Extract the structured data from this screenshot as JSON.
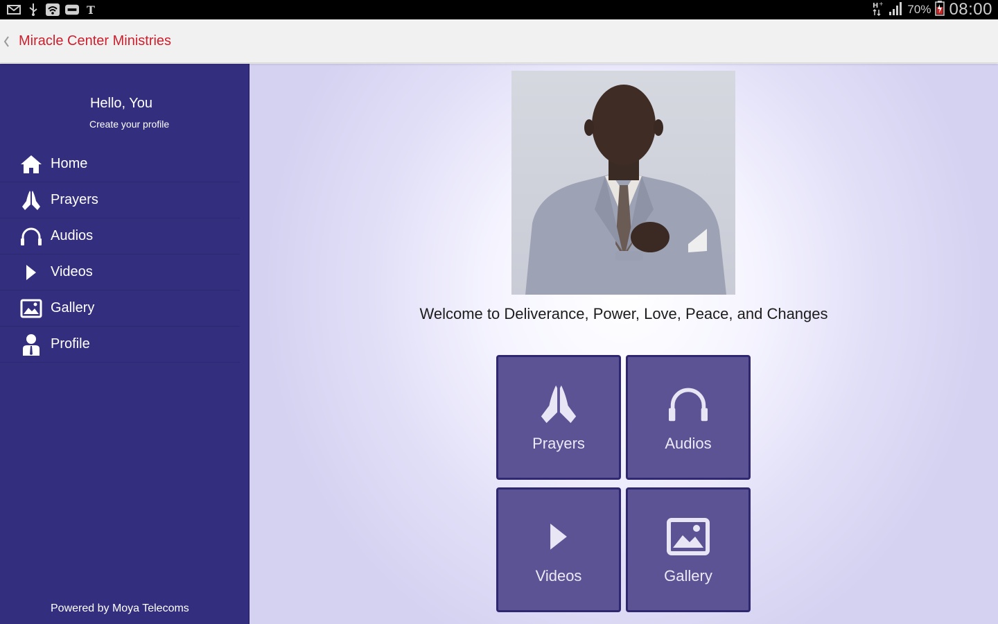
{
  "status_bar": {
    "battery_percent": "70%",
    "time": "08:00",
    "icons": [
      "mail-icon",
      "usb-icon",
      "wifi-icon",
      "storage-icon",
      "nyt-icon",
      "network-type-icon",
      "signal-icon",
      "battery-icon"
    ]
  },
  "action_bar": {
    "title": "Miracle Center Ministries",
    "title_color": "#cc1f2d"
  },
  "drawer": {
    "greeting": "Hello, You",
    "profile_link": "Create your profile",
    "items": [
      {
        "label": "Home",
        "icon": "home-icon"
      },
      {
        "label": "Prayers",
        "icon": "praying-hands-icon"
      },
      {
        "label": "Audios",
        "icon": "headphones-icon"
      },
      {
        "label": "Videos",
        "icon": "play-icon"
      },
      {
        "label": "Gallery",
        "icon": "image-icon"
      },
      {
        "label": "Profile",
        "icon": "user-icon"
      }
    ],
    "footer": "Powered by Moya Telecoms",
    "background_color": "#332f7e"
  },
  "main": {
    "welcome_text": "Welcome to Deliverance, Power, Love, Peace, and Changes",
    "tiles": [
      {
        "label": "Prayers",
        "icon": "praying-hands-icon"
      },
      {
        "label": "Audios",
        "icon": "headphones-icon"
      },
      {
        "label": "Videos",
        "icon": "play-icon"
      },
      {
        "label": "Gallery",
        "icon": "image-icon"
      }
    ],
    "tile_color": "#5b5394"
  }
}
